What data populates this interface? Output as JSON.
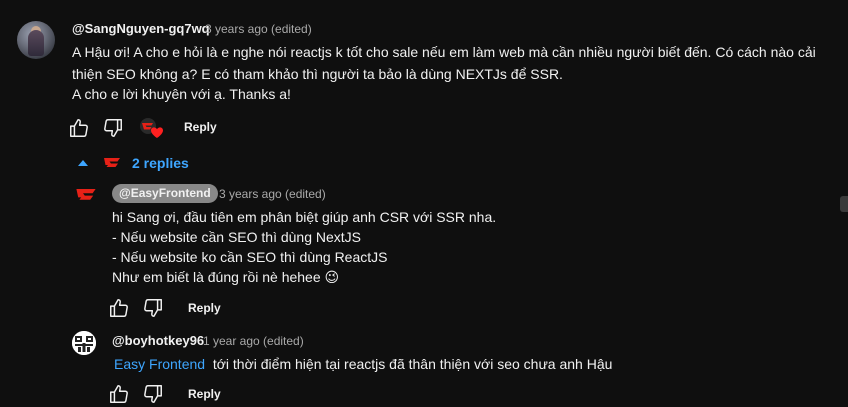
{
  "comments": {
    "top": {
      "author": "@SangNguyen-gq7wq",
      "time": "3 years ago (edited)",
      "lines": [
        "A Hậu ơi! A cho e hỏi là e nghe nói reactjs k tốt cho sale nếu em làm web mà cần nhiều người biết đến. Có cách nào cải",
        "thiện SEO không a? E có tham khảo thì người ta bảo là dùng NEXTJs để SSR.",
        "A cho e lời khuyên với ạ. Thanks a!"
      ],
      "reply_label": "Reply"
    },
    "replies_toggle": {
      "label": "2 replies"
    },
    "reply1": {
      "author": "@EasyFrontend",
      "time": "3 years ago (edited)",
      "lines": [
        "hi Sang ơi, đầu tiên em phân biệt giúp anh CSR với SSR nha.",
        "- Nếu website cần SEO thì dùng NextJS",
        "- Nếu website ko cần SEO thì dùng ReactJS",
        "Như em biết là đúng rồi nè hehee 😉"
      ],
      "reply_label": "Reply"
    },
    "reply2": {
      "author": "@boyhotkey96",
      "time": "1 year ago (edited)",
      "mention": "Easy Frontend",
      "text": "tới thời điểm hiện tại reactjs đã thân thiện với seo chưa anh Hậu",
      "reply_label": "Reply"
    }
  },
  "colors": {
    "background": "#0f0f0f",
    "text": "#f1f1f1",
    "meta": "#aaaaaa",
    "accent_blue": "#3ea6ff",
    "brand_red": "#e62117",
    "badge_bg": "#888888"
  },
  "icons": {
    "like": "thumbs-up-icon",
    "dislike": "thumbs-down-icon",
    "creator_heart": "creator-heart-icon",
    "channel_logo": "easy-frontend-logo-icon",
    "caret": "caret-up-icon"
  }
}
